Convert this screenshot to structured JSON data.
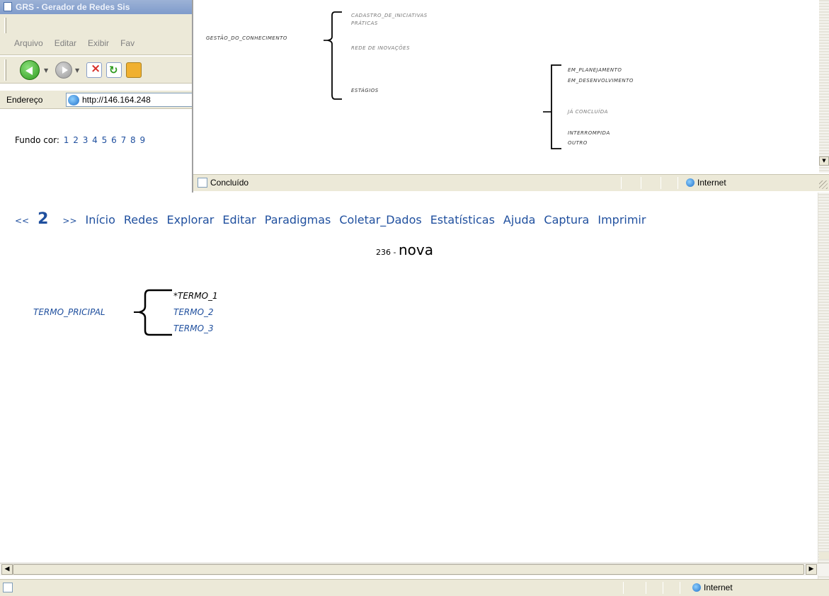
{
  "main_window": {
    "title": "GRS - Gerador de Redes Sis",
    "menu": [
      "Arquivo",
      "Editar",
      "Exibir",
      "Fav"
    ],
    "address_label": "Endereço",
    "address_value": "http://146.164.248",
    "fundo_label": "Fundo cor:",
    "fundo_options": [
      "1",
      "2",
      "3",
      "4",
      "5",
      "6",
      "7",
      "8",
      "9"
    ],
    "nav": {
      "prev": "<<",
      "page": "2",
      "next": ">>",
      "links": [
        "Início",
        "Redes",
        "Explorar",
        "Editar",
        "Paradigmas",
        "Coletar_Dados",
        "Estatísticas",
        "Ajuda",
        "Captura",
        "Imprimir"
      ]
    },
    "page_title": {
      "id": "236 - ",
      "name": "nova"
    },
    "tree": {
      "root": "TERMO_PRICIPAL",
      "children": [
        "*TERMO_1",
        "TERMO_2",
        "TERMO_3"
      ]
    },
    "status_zone": "Internet"
  },
  "popup": {
    "status_text": "Concluído",
    "status_zone": "Internet",
    "tree": {
      "root": "GESTÃO_DO_CONHECIMENTO",
      "children": [
        "CADASTRO_DE_INICIATIVAS",
        "PRÁTICAS",
        "REDE DE INOVAÇÕES",
        "ESTÁGIOS"
      ],
      "sub_children": [
        "EM_PLANEJAMENTO",
        "EM_DESENVOLVIMENTO",
        "JÁ CONCLUÍDA",
        "INTERROMPIDA",
        "OUTRO"
      ]
    }
  },
  "icons": [
    "app-icon",
    "back-icon",
    "forward-icon",
    "stop-icon",
    "refresh-icon",
    "home-icon",
    "ie-page-icon",
    "internet-zone-icon",
    "page-status-icon"
  ]
}
